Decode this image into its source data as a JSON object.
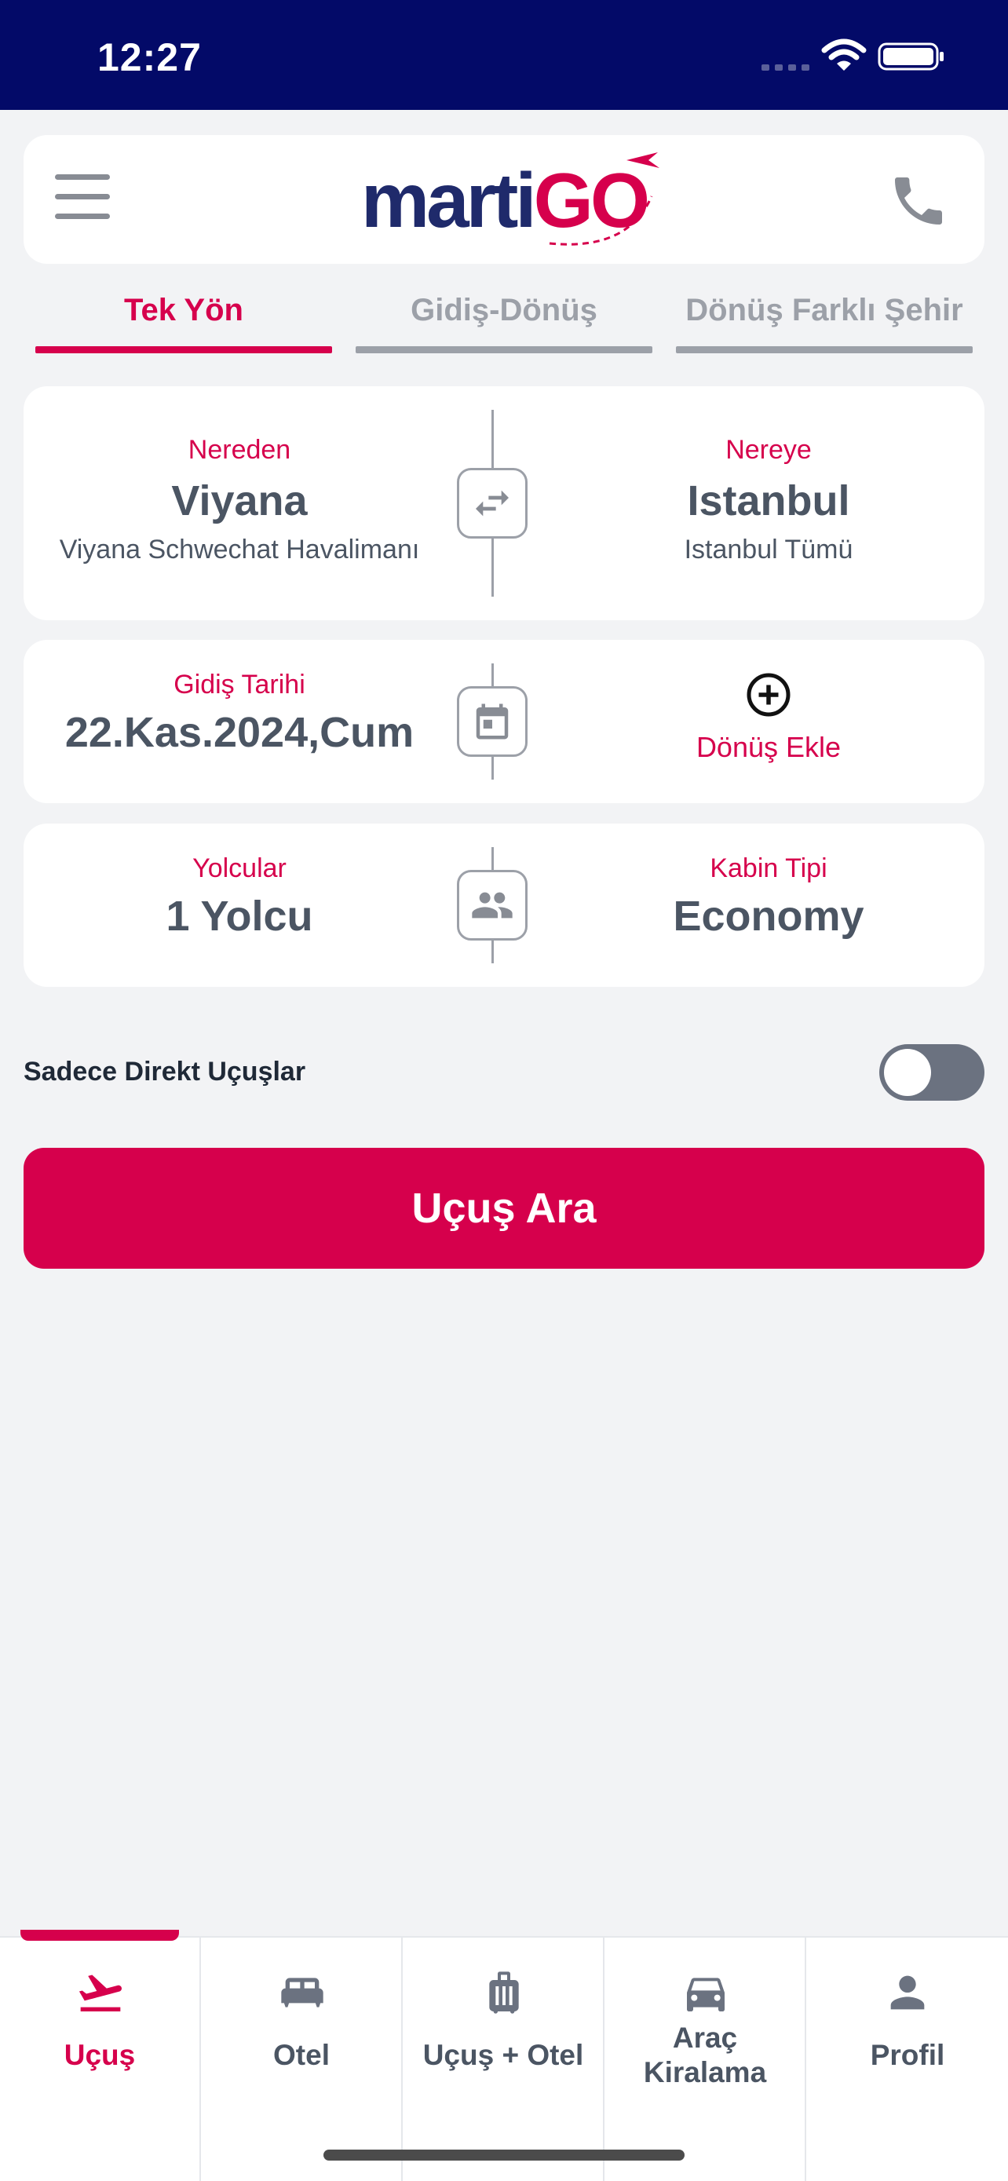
{
  "status_bar": {
    "time": "12:27"
  },
  "header": {
    "logo_part1": "marti",
    "logo_part2": "GO"
  },
  "trip_tabs": [
    {
      "label": "Tek Yön",
      "active": true
    },
    {
      "label": "Gidiş-Dönüş",
      "active": false
    },
    {
      "label": "Dönüş Farklı Şehir",
      "active": false
    }
  ],
  "route": {
    "from_label": "Nereden",
    "from_city": "Viyana",
    "from_airport": "Viyana Schwechat Havalimanı",
    "to_label": "Nereye",
    "to_city": "Istanbul",
    "to_airport": "Istanbul Tümü"
  },
  "dates": {
    "departure_label": "Gidiş Tarihi",
    "departure_value": "22.Kas.2024,Cum",
    "return_add_label": "Dönüş Ekle"
  },
  "passengers": {
    "passengers_label": "Yolcular",
    "passengers_value": "1 Yolcu",
    "cabin_label": "Kabin Tipi",
    "cabin_value": "Economy"
  },
  "filters": {
    "direct_only_label": "Sadece Direkt Uçuşlar",
    "direct_only_enabled": false
  },
  "search_button_label": "Uçuş Ara",
  "bottom_nav": [
    {
      "label": "Uçuş",
      "icon": "flight-takeoff-icon",
      "active": true
    },
    {
      "label": "Otel",
      "icon": "bed-icon",
      "active": false
    },
    {
      "label": "Uçuş + Otel",
      "icon": "luggage-icon",
      "active": false
    },
    {
      "label": "Araç Kiralama",
      "label_line1": "Araç",
      "label_line2": "Kiralama",
      "icon": "car-icon",
      "active": false
    },
    {
      "label": "Profil",
      "icon": "person-icon",
      "active": false
    }
  ],
  "colors": {
    "status_bar_bg": "#030a68",
    "accent": "#d6004c",
    "logo_navy": "#1f2a6b",
    "text_gray": "#4b5563",
    "background": "#f2f3f5"
  }
}
